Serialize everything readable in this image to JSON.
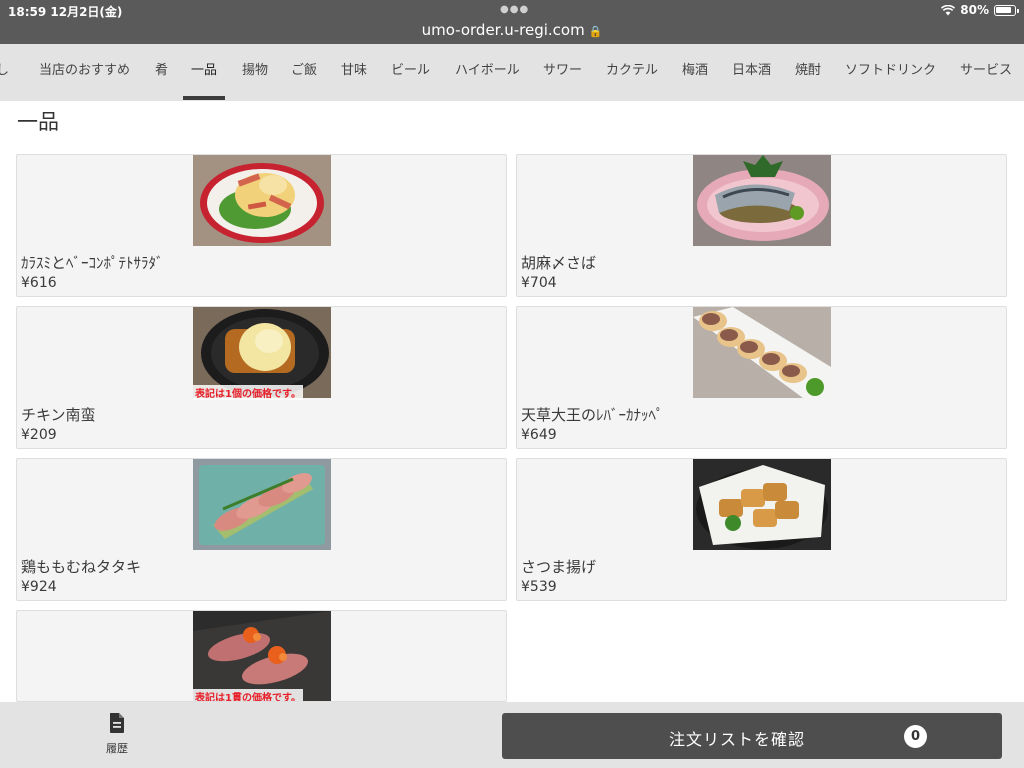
{
  "status_bar": {
    "time_date": "18:59  12月2日(金)",
    "url": "umo-order.u-regi.com",
    "battery": "80%"
  },
  "tabs": [
    {
      "label": "し"
    },
    {
      "label": "当店のおすすめ"
    },
    {
      "label": "肴"
    },
    {
      "label": "一品",
      "active": true
    },
    {
      "label": "揚物"
    },
    {
      "label": "ご飯"
    },
    {
      "label": "甘味"
    },
    {
      "label": "ビール"
    },
    {
      "label": "ハイボール"
    },
    {
      "label": "サワー"
    },
    {
      "label": "カクテル"
    },
    {
      "label": "梅酒"
    },
    {
      "label": "日本酒"
    },
    {
      "label": "焼酎"
    },
    {
      "label": "ソフトドリンク"
    },
    {
      "label": "サービス"
    }
  ],
  "section_title": "一品",
  "items": [
    {
      "name": "ｶﾗｽﾐとﾍﾞｰｺﾝﾎﾟﾃﾄｻﾗﾀﾞ",
      "price": "¥616",
      "photo": "potato-salad-photo",
      "note": ""
    },
    {
      "name": "胡麻〆さば",
      "price": "¥704",
      "photo": "mackerel-photo",
      "note": ""
    },
    {
      "name": "チキン南蛮",
      "price": "¥209",
      "photo": "chicken-nanban-photo",
      "note": "表記は1個の価格です。"
    },
    {
      "name": "天草大王のﾚﾊﾞｰｶﾅｯﾍﾟ",
      "price": "¥649",
      "photo": "liver-canape-photo",
      "note": ""
    },
    {
      "name": "鶏ももむねタタキ",
      "price": "¥924",
      "photo": "chicken-tataki-photo",
      "note": ""
    },
    {
      "name": "さつま揚げ",
      "price": "¥539",
      "photo": "satsuma-age-photo",
      "note": ""
    },
    {
      "name": "",
      "price": "",
      "photo": "aburi-sushi-photo",
      "note": "表記は1貫の価格です。"
    }
  ],
  "bottom_bar": {
    "history_label": "履歴",
    "confirm_label": "注文リストを確認",
    "cart_count": "0"
  },
  "colors": {
    "bar_bg": "#e3e3e3",
    "status_bg": "#5a5a5a",
    "button_bg": "#4e4e4e",
    "note_red": "#e8202a"
  }
}
